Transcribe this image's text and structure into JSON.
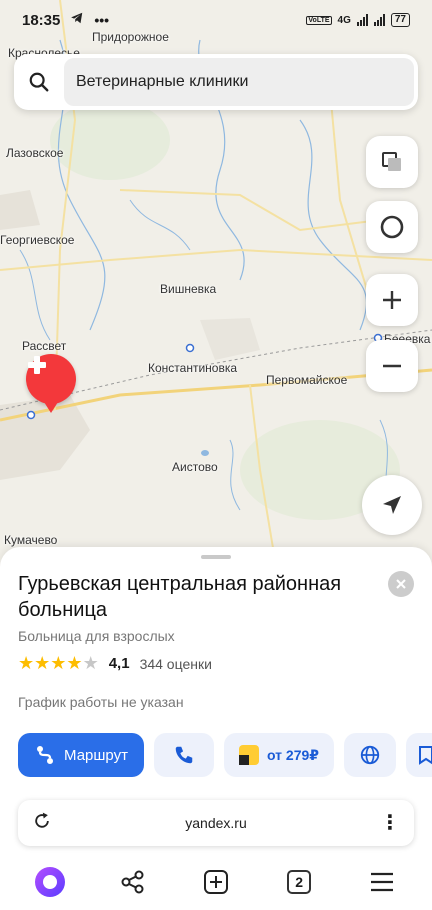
{
  "status": {
    "time": "18:35",
    "network": "4G",
    "volte": "VoLTE",
    "battery": "77"
  },
  "search": {
    "query": "Ветеринарные клиники"
  },
  "map": {
    "places": [
      "Краснолесье",
      "Придорожное",
      "Лазовское",
      "Георгиевское",
      "Вишневка",
      "Рассвет",
      "Константиновка",
      "Первомайское",
      "Аистово",
      "Кумачево",
      "Бееевка"
    ]
  },
  "place_card": {
    "title": "Гурьевская центральная районная больница",
    "category": "Больница для взрослых",
    "rating": "4,1",
    "rating_stars": 4,
    "reviews": "344 оценки",
    "hours": "График работы не указан",
    "route_label": "Маршрут",
    "taxi_price": "от 279₽"
  },
  "browser": {
    "url": "yandex.ru",
    "tabs_count": "2"
  },
  "colors": {
    "accent": "#2a6ee8",
    "pin": "#f3383b",
    "star": "#fdbd00"
  }
}
